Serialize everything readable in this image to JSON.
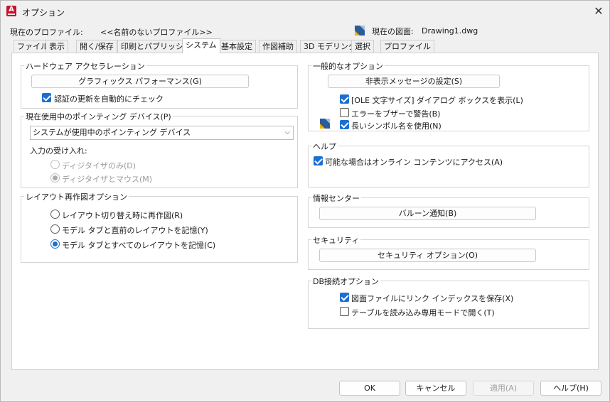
{
  "window": {
    "title": "オプション",
    "app_icon_letter": "A"
  },
  "profile": {
    "current_profile_label": "現在のプロファイル:",
    "current_profile_value": "<<名前のないプロファイル>>",
    "current_drawing_label": "現在の図面:",
    "current_drawing_value": "Drawing1.dwg"
  },
  "tabs": [
    "ファイル",
    "表示",
    "開く/保存",
    "印刷とパブリッシュ",
    "システム",
    "基本設定",
    "作図補助",
    "3D モデリング",
    "選択",
    "プロファイル"
  ],
  "active_tab": "システム",
  "hardware": {
    "title": "ハードウェア アクセラレーション",
    "graphics_button": "グラフィックス パフォーマンス(G)",
    "check_updates_label": "認証の更新を自動的にチェック"
  },
  "pointing": {
    "title": "現在使用中のポインティング デバイス(P)",
    "device_value": "システムが使用中のポインティング デバイス",
    "input_label": "入力の受け入れ:",
    "radio_digitizer_only": "ディジタイザのみ(D)",
    "radio_digitizer_mouse": "ディジタイザとマウス(M)"
  },
  "layout_regen": {
    "title": "レイアウト再作図オプション",
    "radio_1": "レイアウト切り替え時に再作図(R)",
    "radio_2": "モデル タブと直前のレイアウトを記憶(Y)",
    "radio_3": "モデル タブとすべてのレイアウトを記憶(C)"
  },
  "general": {
    "title": "一般的なオプション",
    "hidden_messages_button": "非表示メッセージの設定(S)",
    "check_ole": "[OLE 文字サイズ] ダイアログ ボックスを表示(L)",
    "check_beep": "エラーをブザーで警告(B)",
    "check_long_names": "長いシンボル名を使用(N)"
  },
  "help": {
    "title": "ヘルプ",
    "check_online": "可能な場合はオンライン コンテンツにアクセス(A)"
  },
  "info_center": {
    "title": "情報センター",
    "balloon_button": "バルーン通知(B)"
  },
  "security": {
    "title": "セキュリティ",
    "security_button": "セキュリティ オプション(O)"
  },
  "db": {
    "title": "DB接続オプション",
    "check_link_index": "図面ファイルにリンク インデックスを保存(X)",
    "check_readonly": "テーブルを読み込み専用モードで開く(T)"
  },
  "footer": {
    "ok": "OK",
    "cancel": "キャンセル",
    "apply": "適用(A)",
    "help": "ヘルプ(H)"
  },
  "colors": {
    "accent": "#1b6fd3",
    "app_icon": "#c8102e"
  }
}
